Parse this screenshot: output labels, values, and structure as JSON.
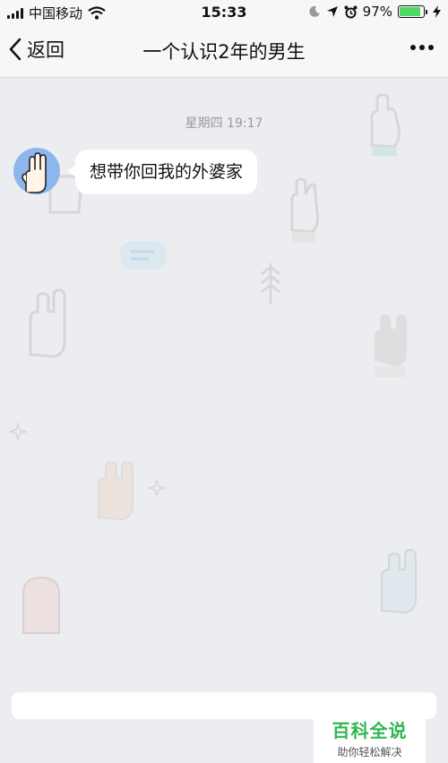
{
  "status_bar": {
    "carrier": "中国移动",
    "time": "15:33",
    "battery_percent": "97%",
    "battery_level": 0.97,
    "icons": [
      "signal-icon",
      "wifi-icon",
      "moon-icon",
      "location-icon",
      "alarm-icon",
      "battery-icon",
      "charging-icon"
    ]
  },
  "nav": {
    "back_label": "返回",
    "title": "一个认识2年的男生",
    "more_icon": "more-icon"
  },
  "chat": {
    "timestamp": "星期四 19:17",
    "messages": [
      {
        "sender": "contact",
        "text": "想带你回我的外婆家"
      }
    ]
  },
  "watermark": {
    "brand": "百科全说",
    "slogan": "助你轻松解决"
  },
  "colors": {
    "background": "#ebedf0",
    "bar": "#f7f7f7",
    "bubble": "#ffffff",
    "avatar": "#8db6ee",
    "brand_green": "#2fb84f",
    "battery_green": "#4cd964"
  }
}
